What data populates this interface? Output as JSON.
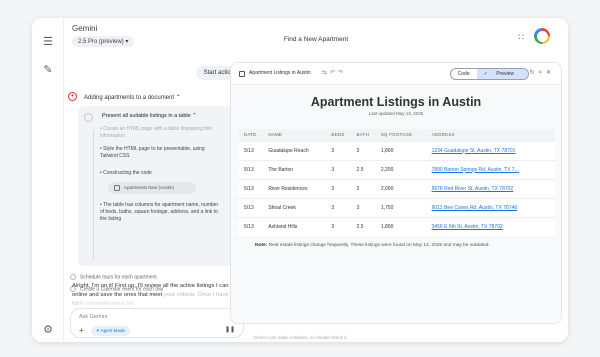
{
  "app": {
    "name": "Gemini",
    "model": "2.5 Pro (preview)",
    "doc_title": "Find a New Apartment"
  },
  "chat": {
    "start_action": "Start action",
    "task_title": "Adding apartments to a document",
    "step_title": "Present all suitable listings in a table",
    "sub_faded": "• Create an HTML page with a table displaying this information",
    "sub1": "• Style the HTML page to be presentable, using Tailwind CSS",
    "sub2": "• Constructing the code",
    "file_pill": "Apartments New (Austin)",
    "sub3": "• The table has columns for apartment name, number of beds, baths, square footage, address, and a link to the listing",
    "check1": "Schedule tours for each apartment",
    "check2": "Create a Calendar event for each tour",
    "reply": "Alright, I'm on it! First up, I'll review all the active listings I can find online and save the ones that meet",
    "reply_fade": "your criteria. Once I have a fairly comprehensive list",
    "composer_placeholder": "Ask Gemini",
    "agent_mode": "Agent Mode"
  },
  "canvas": {
    "file_name": "Apartment Listings in Austin",
    "code_label": "Code",
    "preview_label": "Preview",
    "page_title": "Apartment Listings in Austin",
    "updated": "Last updated May 13, 2025",
    "headers": [
      "DATE",
      "NAME",
      "BEDS",
      "BATH",
      "SQ FOOTAGE",
      "ADDRESS"
    ],
    "rows": [
      [
        "5/13",
        "Guadalupe Reach",
        "3",
        "3",
        "1,800",
        "1234 Guadalupe St, Austin, TX 78701"
      ],
      [
        "5/13",
        "The Barton",
        "3",
        "2.5",
        "2,200",
        "7890 Barton Springs Rd, Austin, TX 7..."
      ],
      [
        "5/13",
        "River Residences",
        "3",
        "3",
        "2,000",
        "5678 Red River St, Austin, TX 78702"
      ],
      [
        "5/13",
        "Shoal Creek",
        "3",
        "3",
        "1,750",
        "9012 Bee Caves Rd, Austin, TX 78746"
      ],
      [
        "5/13",
        "Ashland Hills",
        "3",
        "2.5",
        "1,800",
        "3456 E 6th St, Austin, TX 78702"
      ]
    ],
    "note_label": "Note:",
    "note_text": "Real estate listings change frequently. These listings were found on May 13, 2025 and may be outdated."
  },
  "footer": "Gemini can make mistakes, so double-check it"
}
